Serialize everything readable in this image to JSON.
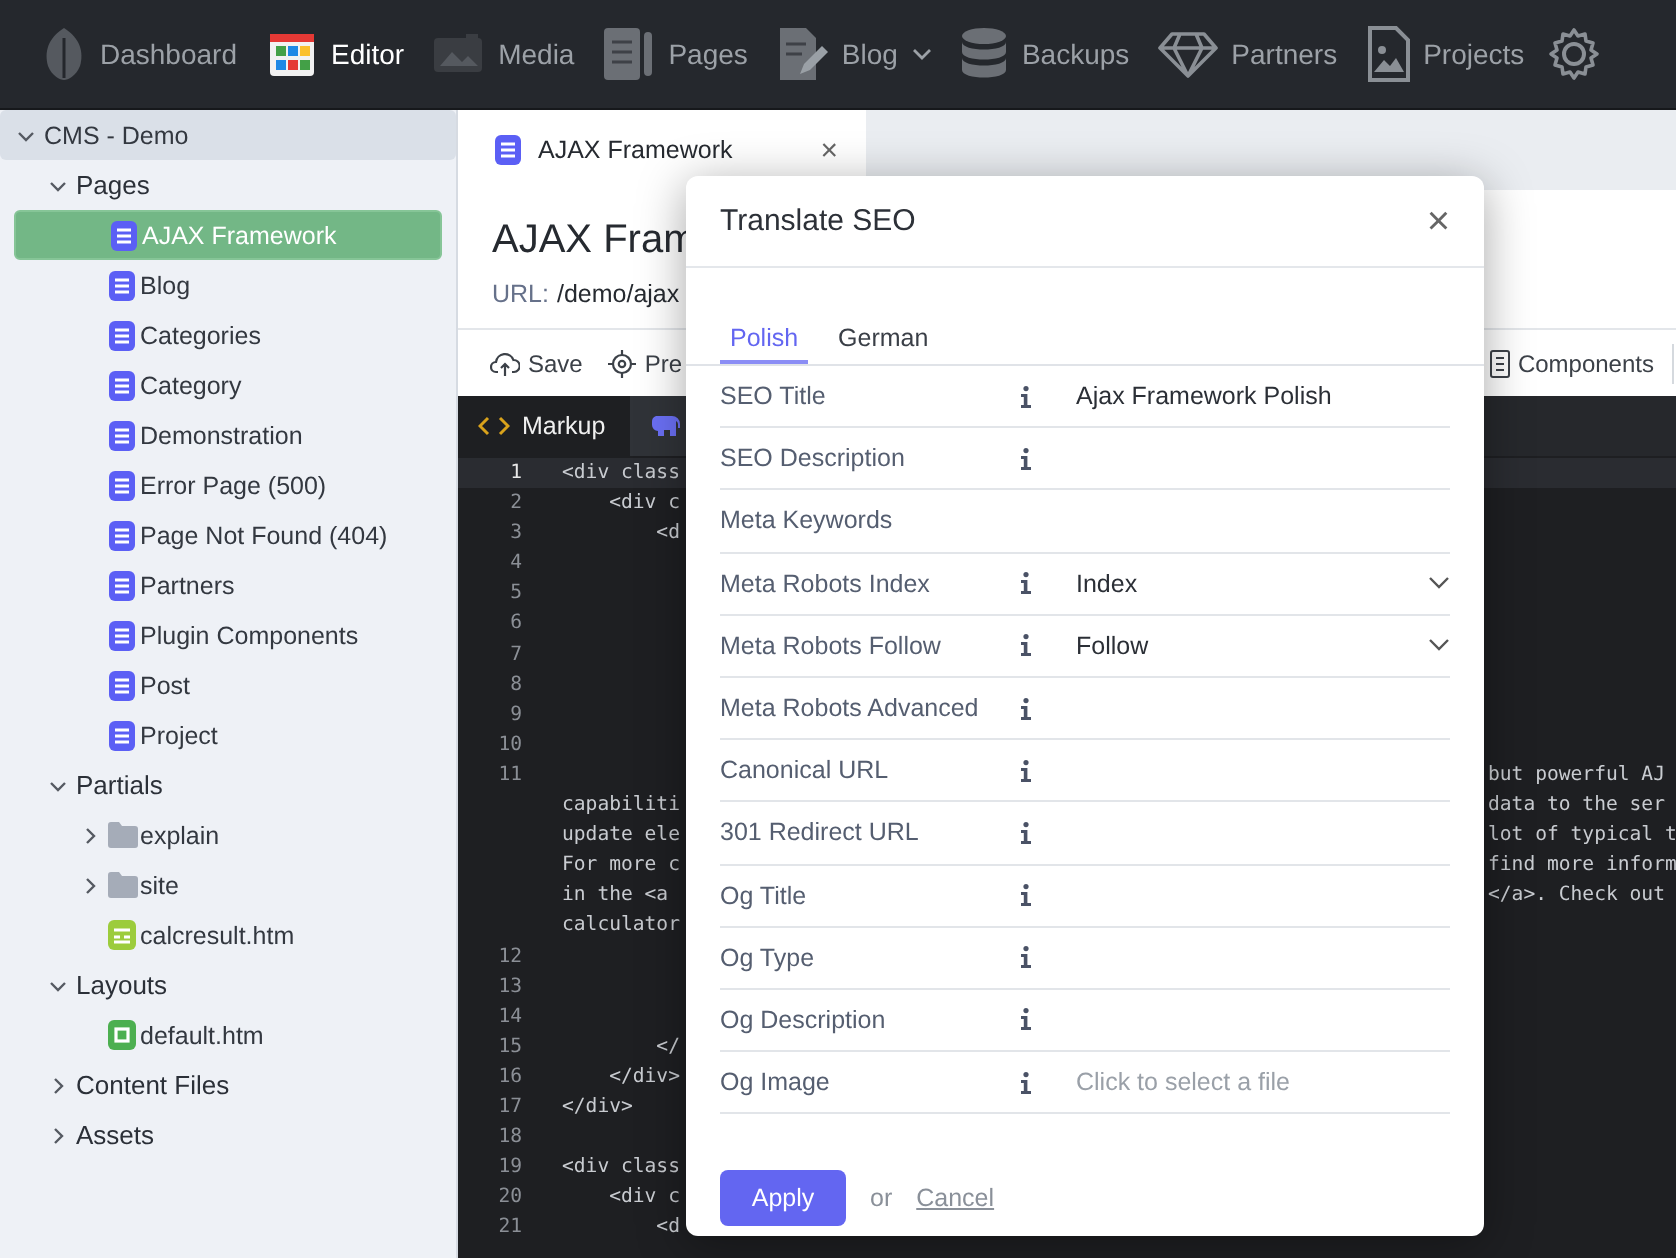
{
  "nav": [
    {
      "label": "Dashboard",
      "selected": false,
      "has_menu": false
    },
    {
      "label": "Editor",
      "selected": true,
      "has_menu": false
    },
    {
      "label": "Media",
      "selected": false,
      "has_menu": false
    },
    {
      "label": "Pages",
      "selected": false,
      "has_menu": false
    },
    {
      "label": "Blog",
      "selected": false,
      "has_menu": true
    },
    {
      "label": "Backups",
      "selected": false,
      "has_menu": false
    },
    {
      "label": "Partners",
      "selected": false,
      "has_menu": false
    },
    {
      "label": "Projects",
      "selected": false,
      "has_menu": false
    }
  ],
  "sidebar": {
    "tree": [
      {
        "label": "CMS - Demo",
        "kind": "project",
        "expanded": true,
        "selected": false,
        "children": [
          {
            "label": "Pages",
            "kind": "group",
            "expanded": true,
            "selected": false,
            "children": [
              {
                "label": "AJAX Framework",
                "kind": "page",
                "selected": true
              },
              {
                "label": "Blog",
                "kind": "page",
                "selected": false
              },
              {
                "label": "Categories",
                "kind": "page",
                "selected": false
              },
              {
                "label": "Category",
                "kind": "page",
                "selected": false
              },
              {
                "label": "Demonstration",
                "kind": "page",
                "selected": false
              },
              {
                "label": "Error Page (500)",
                "kind": "page",
                "selected": false
              },
              {
                "label": "Page Not Found (404)",
                "kind": "page",
                "selected": false
              },
              {
                "label": "Partners",
                "kind": "page",
                "selected": false
              },
              {
                "label": "Plugin Components",
                "kind": "page",
                "selected": false
              },
              {
                "label": "Post",
                "kind": "page",
                "selected": false
              },
              {
                "label": "Project",
                "kind": "page",
                "selected": false
              }
            ]
          },
          {
            "label": "Partials",
            "kind": "group",
            "expanded": true,
            "selected": false,
            "children": [
              {
                "label": "explain",
                "kind": "folder",
                "expanded": false,
                "selected": false
              },
              {
                "label": "site",
                "kind": "folder",
                "expanded": false,
                "selected": false
              },
              {
                "label": "calcresult.htm",
                "kind": "partial",
                "selected": false
              }
            ]
          },
          {
            "label": "Layouts",
            "kind": "group",
            "expanded": true,
            "selected": false,
            "children": [
              {
                "label": "default.htm",
                "kind": "layout",
                "selected": false
              }
            ]
          },
          {
            "label": "Content Files",
            "kind": "group",
            "expanded": false,
            "selected": false
          },
          {
            "label": "Assets",
            "kind": "group",
            "expanded": false,
            "selected": false
          }
        ]
      }
    ]
  },
  "document_tab": {
    "label": "AJAX Framework",
    "close": "×"
  },
  "page_header": {
    "title": "AJAX Fram",
    "url_label": "URL:",
    "url": "/demo/ajax"
  },
  "toolbar": {
    "save": "Save",
    "preview": "Pre",
    "components": "Components"
  },
  "editor": {
    "tabs": [
      {
        "label": "Markup",
        "kind": "markup",
        "selected": true
      },
      {
        "kind": "php",
        "selected": false
      }
    ],
    "rows": [
      {
        "number": "1",
        "left": "<div class",
        "right": "",
        "current": true
      },
      {
        "number": "2",
        "left": "    <div c",
        "right": "",
        "current": false
      },
      {
        "number": "3",
        "left": "        <d",
        "right": "",
        "current": false
      },
      {
        "number": "4",
        "left": "",
        "right": "",
        "current": false
      },
      {
        "number": "5",
        "left": "",
        "right": "",
        "current": false
      },
      {
        "number": "6",
        "left": "",
        "right": "",
        "current": false
      },
      {
        "number": "7",
        "left": "",
        "right": "",
        "current": false
      },
      {
        "number": "8",
        "left": "",
        "right": "",
        "current": false
      },
      {
        "number": "9",
        "left": "",
        "right": "",
        "current": false
      },
      {
        "number": "10",
        "left": "",
        "right": "",
        "current": false
      },
      {
        "number": "11",
        "left": "",
        "right": "but powerful AJ",
        "current": false
      },
      {
        "number": "",
        "left": "capabiliti",
        "right": "data to the ser",
        "current": false
      },
      {
        "number": "",
        "left": "update ele",
        "right": "lot of typical t",
        "current": false
      },
      {
        "number": "",
        "left": "For more c",
        "right": "find more inform",
        "current": false
      },
      {
        "number": "",
        "left": "in the <a",
        "right": "</a>. Check out",
        "current": false
      },
      {
        "number": "",
        "left": "calculator",
        "right": "",
        "current": false
      },
      {
        "number": "12",
        "left": "",
        "right": "",
        "current": false
      },
      {
        "number": "13",
        "left": "",
        "right": "",
        "current": false
      },
      {
        "number": "14",
        "left": "",
        "right": "",
        "current": false
      },
      {
        "number": "15",
        "left": "        </",
        "right": "",
        "current": false
      },
      {
        "number": "16",
        "left": "    </div>",
        "right": "",
        "current": false
      },
      {
        "number": "17",
        "left": "</div>",
        "right": "",
        "current": false
      },
      {
        "number": "18",
        "left": "",
        "right": "",
        "current": false
      },
      {
        "number": "19",
        "left": "<div class",
        "right": "",
        "current": false
      },
      {
        "number": "20",
        "left": "    <div c",
        "right": "",
        "current": false
      },
      {
        "number": "21",
        "left": "        <d",
        "right": "",
        "current": false
      }
    ]
  },
  "dialog": {
    "title": "Translate SEO",
    "close": "×",
    "tabs": [
      {
        "label": "Polish",
        "selected": true
      },
      {
        "label": "German",
        "selected": false
      }
    ],
    "fields": [
      {
        "label": "SEO Title",
        "info": true,
        "kind": "text",
        "value": "Ajax Framework Polish"
      },
      {
        "label": "SEO Description",
        "info": true,
        "kind": "text"
      },
      {
        "label": "Meta Keywords",
        "info": false,
        "kind": "text"
      },
      {
        "label": "Meta Robots Index",
        "info": true,
        "kind": "select",
        "value": "Index"
      },
      {
        "label": "Meta Robots Follow",
        "info": true,
        "kind": "select",
        "value": "Follow"
      },
      {
        "label": "Meta Robots Advanced",
        "info": true,
        "kind": "text"
      },
      {
        "label": "Canonical URL",
        "info": true,
        "kind": "text"
      },
      {
        "label": "301 Redirect URL",
        "info": true,
        "kind": "text"
      },
      {
        "label": "Og Title",
        "info": true,
        "kind": "text"
      },
      {
        "label": "Og Type",
        "info": true,
        "kind": "text"
      },
      {
        "label": "Og Description",
        "info": true,
        "kind": "text"
      },
      {
        "label": "Og Image",
        "info": true,
        "kind": "file",
        "placeholder": "Click to select a file"
      }
    ],
    "apply": "Apply",
    "or": "or",
    "cancel": "Cancel"
  }
}
